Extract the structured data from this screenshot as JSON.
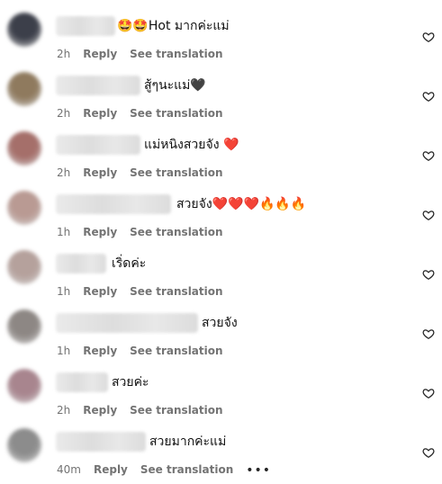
{
  "comments": [
    {
      "text": "🤩🤩Hot มากค่ะแม่",
      "time": "2h",
      "reply_label": "Reply",
      "translation_label": "See translation",
      "avatar_color": "#3c3f4a"
    },
    {
      "text": "สู้ๆนะแม่🖤",
      "time": "2h",
      "reply_label": "Reply",
      "translation_label": "See translation",
      "avatar_color": "#8f7a5e"
    },
    {
      "text": "แม่หนิงสวยจัง ❤️",
      "time": "2h",
      "reply_label": "Reply",
      "translation_label": "See translation",
      "avatar_color": "#a56f6a"
    },
    {
      "text": "สวยจัง❤️❤️❤️🔥🔥🔥",
      "time": "1h",
      "reply_label": "Reply",
      "translation_label": "See translation",
      "avatar_color": "#b99a93"
    },
    {
      "text": "เริ่ดค่ะ",
      "time": "1h",
      "reply_label": "Reply",
      "translation_label": "See translation",
      "avatar_color": "#b5a19c"
    },
    {
      "text": "สวยจัง",
      "time": "1h",
      "reply_label": "Reply",
      "translation_label": "See translation",
      "avatar_color": "#8d8784"
    },
    {
      "text": "สวยค่ะ",
      "time": "2h",
      "reply_label": "Reply",
      "translation_label": "See translation",
      "avatar_color": "#a8858e"
    },
    {
      "text": "สวยมากค่ะแม่",
      "time": "40m",
      "reply_label": "Reply",
      "translation_label": "See translation",
      "more_label": "•••",
      "avatar_color": "#8c8c8c"
    }
  ],
  "colors": {
    "meta": "#737373",
    "text": "#111111",
    "icon": "#262626"
  },
  "icons": {
    "like": "heart-outline-icon",
    "more": "more-options-icon"
  }
}
